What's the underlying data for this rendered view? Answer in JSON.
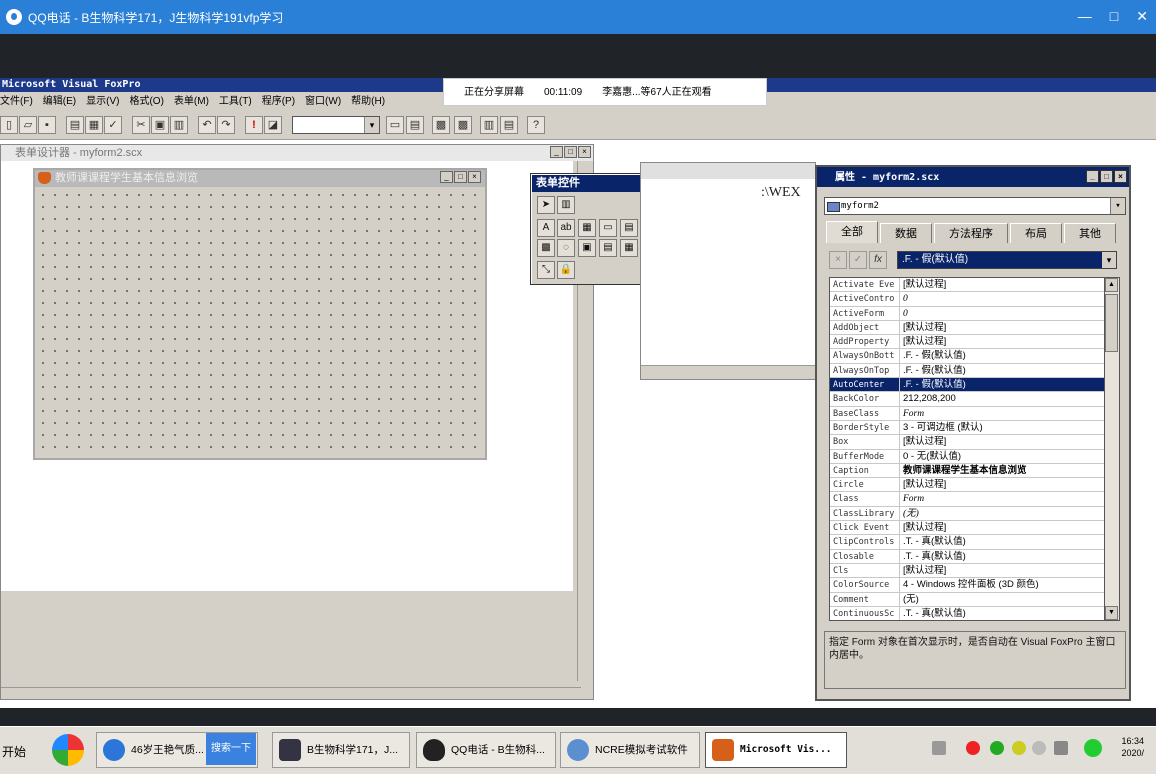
{
  "qq_bar": {
    "title": "QQ电话 - B生物科学171，J生物科学191vfp学习",
    "min_icon": "—",
    "max_icon": "□",
    "close_icon": "✕"
  },
  "share_banner": {
    "status": "正在分享屏幕",
    "elapsed": "00:11:09",
    "viewers": "李嘉惠...等67人正在观看"
  },
  "vfp": {
    "title": "Microsoft Visual FoxPro",
    "menus": [
      "文件(F)",
      "编辑(E)",
      "显示(V)",
      "格式(O)",
      "表单(M)",
      "工具(T)",
      "程序(P)",
      "窗口(W)",
      "帮助(H)"
    ]
  },
  "form_designer": {
    "title": "表单设计器 - myform2.scx",
    "form_caption": "教师课课程学生基本信息浏览"
  },
  "toolbox": {
    "title": "表单控件",
    "close": "×",
    "row1": [
      "➤",
      "▥"
    ],
    "row2": [
      "A",
      "ab",
      "▦",
      "▭",
      "▤",
      "◉",
      "☑",
      "▦",
      "▤",
      "▯",
      "▦"
    ],
    "row3": [
      "▩",
      "◌",
      "▣",
      "▤",
      "▦",
      "╲",
      "◇",
      "▤",
      "▥",
      "◉"
    ],
    "row4": [
      "⤡",
      "🔒"
    ]
  },
  "command_window": {
    "text": ":\\WEX"
  },
  "properties": {
    "title": "属性 - myform2.scx",
    "object": "myform2",
    "tabs": [
      "全部",
      "数据",
      "方法程序",
      "布局",
      "其他"
    ],
    "edit_value": ".F. - 假(默认值)",
    "rows": [
      {
        "name": "Activate Eve",
        "value": "[默认过程]"
      },
      {
        "name": "ActiveContro",
        "value": "0"
      },
      {
        "name": "ActiveForm",
        "value": "0"
      },
      {
        "name": "AddObject",
        "value": "[默认过程]"
      },
      {
        "name": "AddProperty",
        "value": "[默认过程]"
      },
      {
        "name": "AlwaysOnBott",
        "value": ".F. - 假(默认值)"
      },
      {
        "name": "AlwaysOnTop",
        "value": ".F. - 假(默认值)"
      },
      {
        "name": "AutoCenter",
        "value": ".F. - 假(默认值)"
      },
      {
        "name": "BackColor",
        "value": "212,208,200"
      },
      {
        "name": "BaseClass",
        "value": "Form"
      },
      {
        "name": "BorderStyle",
        "value": "3 - 可调边框 (默认)"
      },
      {
        "name": "Box",
        "value": "[默认过程]"
      },
      {
        "name": "BufferMode",
        "value": "0 - 无(默认值)"
      },
      {
        "name": "Caption",
        "value": "教师课课程学生基本信息浏览"
      },
      {
        "name": "Circle",
        "value": "[默认过程]"
      },
      {
        "name": "Class",
        "value": "Form"
      },
      {
        "name": "ClassLibrary",
        "value": "(无)"
      },
      {
        "name": "Click Event",
        "value": "[默认过程]"
      },
      {
        "name": "ClipControls",
        "value": ".T. - 真(默认值)"
      },
      {
        "name": "Closable",
        "value": ".T. - 真(默认值)"
      },
      {
        "name": "Cls",
        "value": "[默认过程]"
      },
      {
        "name": "ColorSource",
        "value": "4 - Windows 控件面板 (3D 颜色)"
      },
      {
        "name": "Comment",
        "value": "(无)"
      },
      {
        "name": "ContinuousSc",
        "value": ".T. - 真(默认值)"
      }
    ],
    "description": "指定 Form 对象在首次显示时，是否自动在 Visual FoxPro 主窗口内居中。"
  },
  "taskbar": {
    "start": "开始",
    "ie_label": "46岁王艳气质...",
    "search_label": "搜索一下",
    "buttons": [
      {
        "label": "B生物科学171，J..."
      },
      {
        "label": "QQ电话 - B生物科..."
      },
      {
        "label": "NCRE模拟考试软件"
      },
      {
        "label": "Microsoft Vis..."
      }
    ],
    "time": "16:34",
    "date": "2020/"
  },
  "colors": {
    "qq_blue": "#2a7fd6",
    "vfp_title": "#0a246a",
    "win_face": "#d4d0c8"
  }
}
